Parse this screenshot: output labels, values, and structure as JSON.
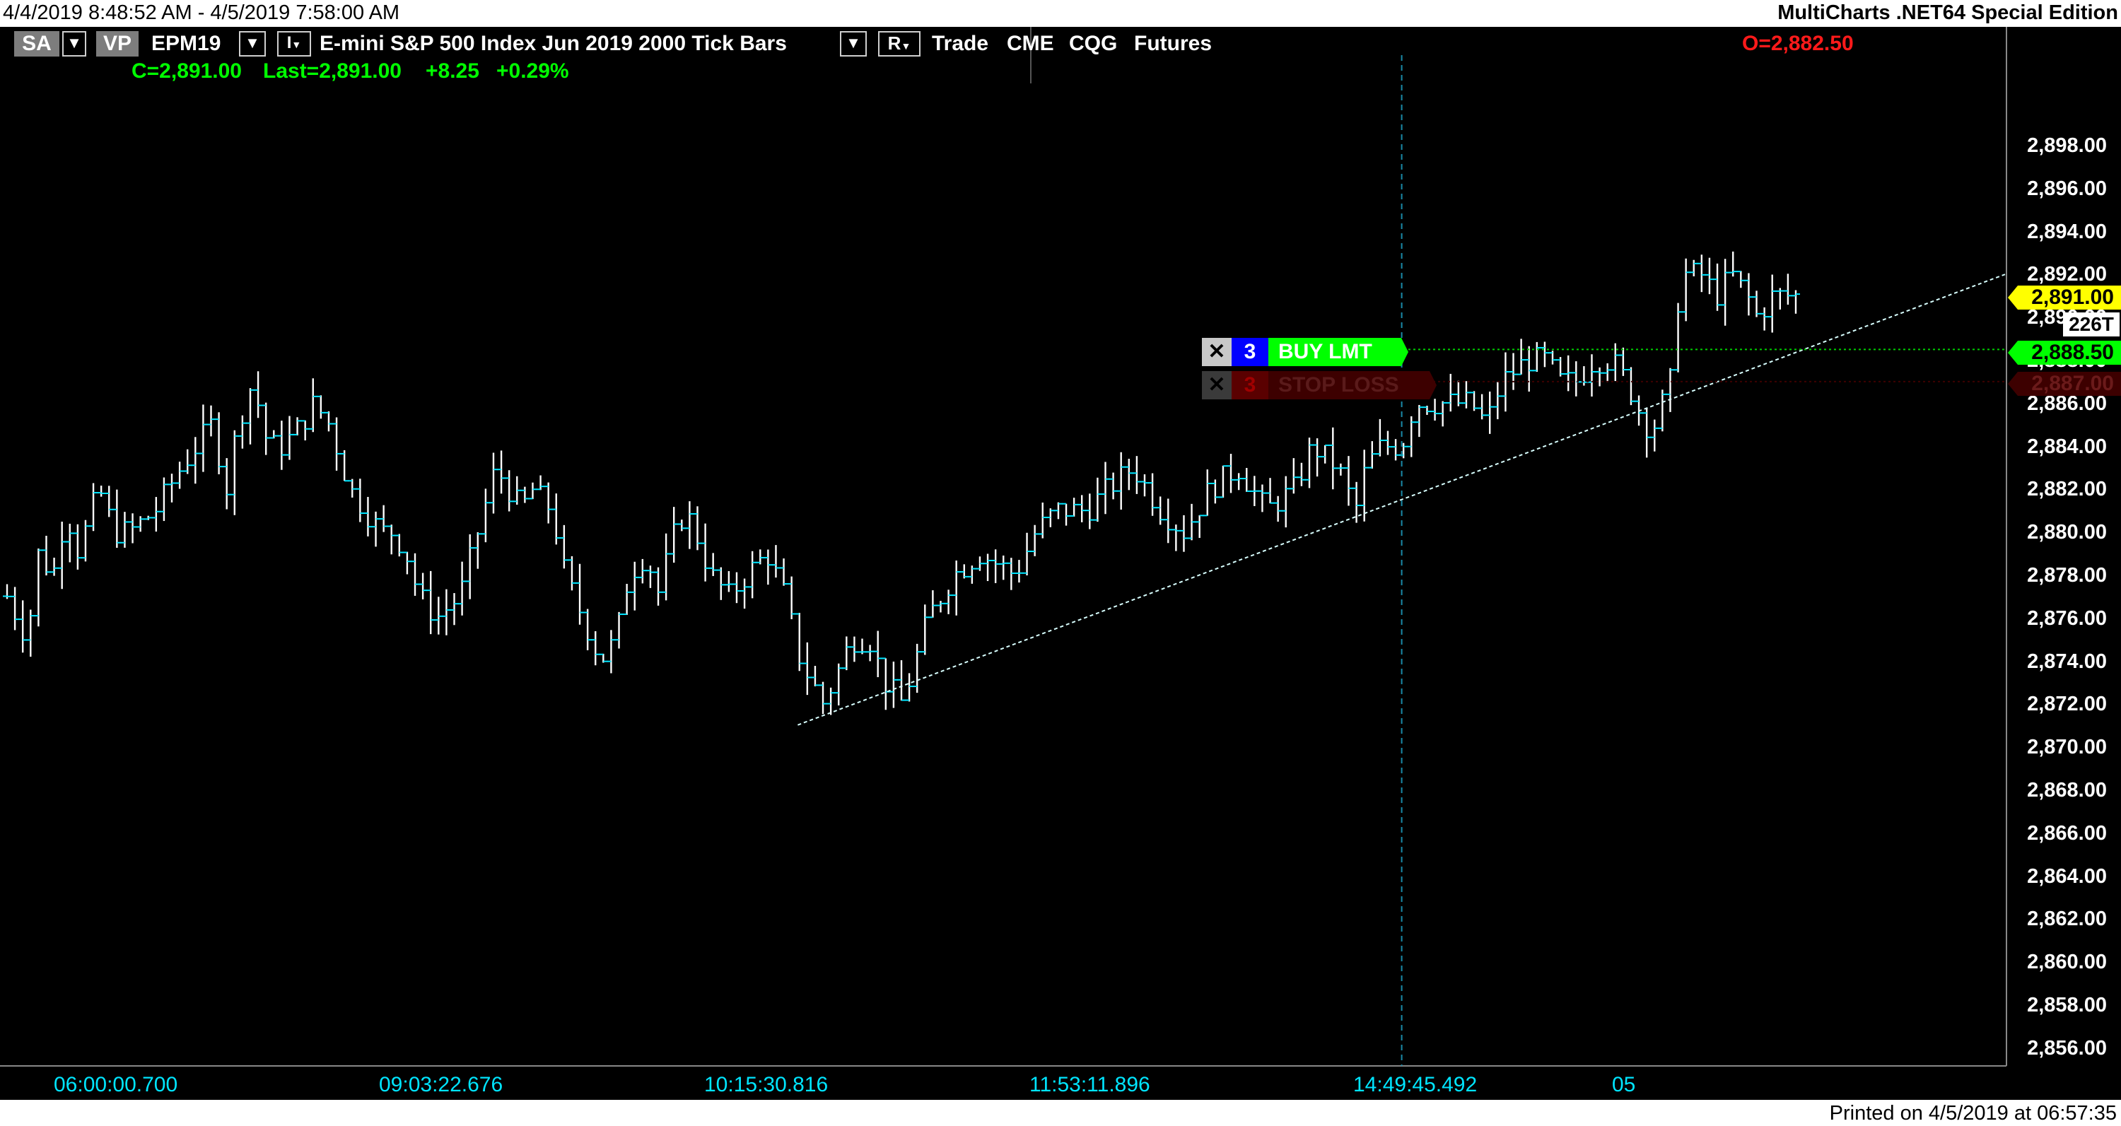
{
  "window": {
    "date_range": "4/4/2019 8:48:52 AM - 4/5/2019 7:58:00 AM",
    "app_title": "MultiCharts .NET64 Special Edition"
  },
  "toolbar": {
    "sa_label": "SA",
    "vp_label": "VP",
    "symbol": "EPM19",
    "interval_label": "I",
    "description": "E-mini S&P 500 Index Jun 2019  2000 Tick Bars",
    "r_label": "R",
    "trade": "Trade",
    "exchange": "CME",
    "feed": "CQG",
    "category": "Futures",
    "open_text": "O=2,882.50",
    "close_text": "C=2,891.00",
    "last_text": "Last=2,891.00",
    "change": "+8.25",
    "change_pct": "+0.29%"
  },
  "orders": {
    "buy": {
      "close_glyph": "✕",
      "qty": "3",
      "label": "BUY LMT",
      "price_tag": "2,888.50"
    },
    "stop": {
      "close_glyph": "✕",
      "qty": "3",
      "label": "STOP LOSS",
      "price_tag": "2,887.00"
    }
  },
  "price_axis": {
    "labels": [
      "2,898.00",
      "2,896.00",
      "2,894.00",
      "2,892.00",
      "2,890.00",
      "2,888.00",
      "2,886.00",
      "2,884.00",
      "2,882.00",
      "2,880.00",
      "2,878.00",
      "2,876.00",
      "2,874.00",
      "2,872.00",
      "2,870.00",
      "2,868.00",
      "2,866.00",
      "2,864.00",
      "2,862.00",
      "2,860.00",
      "2,858.00",
      "2,856.00"
    ],
    "last_price_tag": "2,891.00",
    "tick_count_tag": "226T"
  },
  "time_axis": {
    "labels": [
      "06:00:00.700",
      "09:03:22.676",
      "10:15:30.816",
      "11:53:11.896",
      "14:49:45.492",
      "05"
    ]
  },
  "footer": {
    "printed": "Printed on 4/5/2019 at 06:57:35"
  },
  "colors": {
    "background": "#000000",
    "bar": "#ffffff",
    "bar_tick": "#00e5ff",
    "green": "#00ff00",
    "red": "#ff0000",
    "yellow": "#ffff00",
    "cyan": "#00e5ff",
    "buy_qty_bg": "#0000ff",
    "stop_dark": "#5a0000"
  },
  "chart_data": {
    "type": "ohlc",
    "ylim": [
      2855,
      2900
    ],
    "bar_count": 229,
    "path": [
      [
        0,
        2877
      ],
      [
        8,
        2875
      ],
      [
        12,
        2879
      ],
      [
        18,
        2878
      ],
      [
        23,
        2881
      ],
      [
        28,
        2879
      ],
      [
        33,
        2881
      ],
      [
        36,
        2882
      ],
      [
        42,
        2880
      ],
      [
        48,
        2880
      ],
      [
        58,
        2881
      ],
      [
        68,
        2883
      ],
      [
        80,
        2885
      ],
      [
        86,
        2882
      ],
      [
        90,
        2885
      ],
      [
        96,
        2887
      ],
      [
        102,
        2884
      ],
      [
        108,
        2884
      ],
      [
        115,
        2885
      ],
      [
        120,
        2886
      ],
      [
        126,
        2885
      ],
      [
        134,
        2882
      ],
      [
        140,
        2881
      ],
      [
        146,
        2880
      ],
      [
        151,
        2880
      ],
      [
        156,
        2879
      ],
      [
        161,
        2877
      ],
      [
        168,
        2876
      ],
      [
        177,
        2877
      ],
      [
        184,
        2880
      ],
      [
        191,
        2883
      ],
      [
        196,
        2882
      ],
      [
        201,
        2881
      ],
      [
        205,
        2882
      ],
      [
        213,
        2881
      ],
      [
        218,
        2878
      ],
      [
        225,
        2876
      ],
      [
        232,
        2874
      ],
      [
        238,
        2875
      ],
      [
        243,
        2878
      ],
      [
        250,
        2879
      ],
      [
        254,
        2877
      ],
      [
        261,
        2880
      ],
      [
        265,
        2881
      ],
      [
        269,
        2880
      ],
      [
        275,
        2878
      ],
      [
        282,
        2877
      ],
      [
        289,
        2878
      ],
      [
        297,
        2879
      ],
      [
        304,
        2877
      ],
      [
        310,
        2874
      ],
      [
        319,
        2872
      ],
      [
        323,
        2873
      ],
      [
        330,
        2875
      ],
      [
        337,
        2875
      ],
      [
        343,
        2873
      ],
      [
        350,
        2872
      ],
      [
        355,
        2874
      ],
      [
        360,
        2876
      ],
      [
        365,
        2877
      ],
      [
        370,
        2878
      ],
      [
        380,
        2879
      ],
      [
        394,
        2878
      ],
      [
        402,
        2880
      ],
      [
        410,
        2881
      ],
      [
        422,
        2881
      ],
      [
        430,
        2882
      ],
      [
        440,
        2883
      ],
      [
        451,
        2881
      ],
      [
        460,
        2880
      ],
      [
        470,
        2882
      ],
      [
        481,
        2883
      ],
      [
        492,
        2881
      ],
      [
        503,
        2882
      ],
      [
        510,
        2884
      ],
      [
        520,
        2883
      ],
      [
        527,
        2881
      ],
      [
        531,
        2883
      ],
      [
        537,
        2884
      ],
      [
        545,
        2884
      ],
      [
        550,
        2886
      ],
      [
        558,
        2886
      ],
      [
        567,
        2886
      ],
      [
        572,
        2886
      ],
      [
        578,
        2885
      ],
      [
        584,
        2887
      ],
      [
        594,
        2888
      ],
      [
        602,
        2888
      ],
      [
        606,
        2887
      ],
      [
        613,
        2887
      ],
      [
        620,
        2888
      ],
      [
        627,
        2888
      ],
      [
        633,
        2887
      ],
      [
        640,
        2885
      ],
      [
        644,
        2885
      ],
      [
        650,
        2887
      ],
      [
        654,
        2892
      ],
      [
        662,
        2892
      ],
      [
        668,
        2891
      ],
      [
        674,
        2892
      ],
      [
        680,
        2891
      ],
      [
        684,
        2890
      ],
      [
        690,
        2891
      ],
      [
        699,
        2891
      ]
    ],
    "trendline": {
      "from": [
        309,
        2871
      ],
      "to": [
        750,
        2892
      ]
    },
    "cursor_x": 545,
    "buy_limit_price": 2888.5,
    "stop_loss_price": 2887.0,
    "last_price": 2891.0
  }
}
